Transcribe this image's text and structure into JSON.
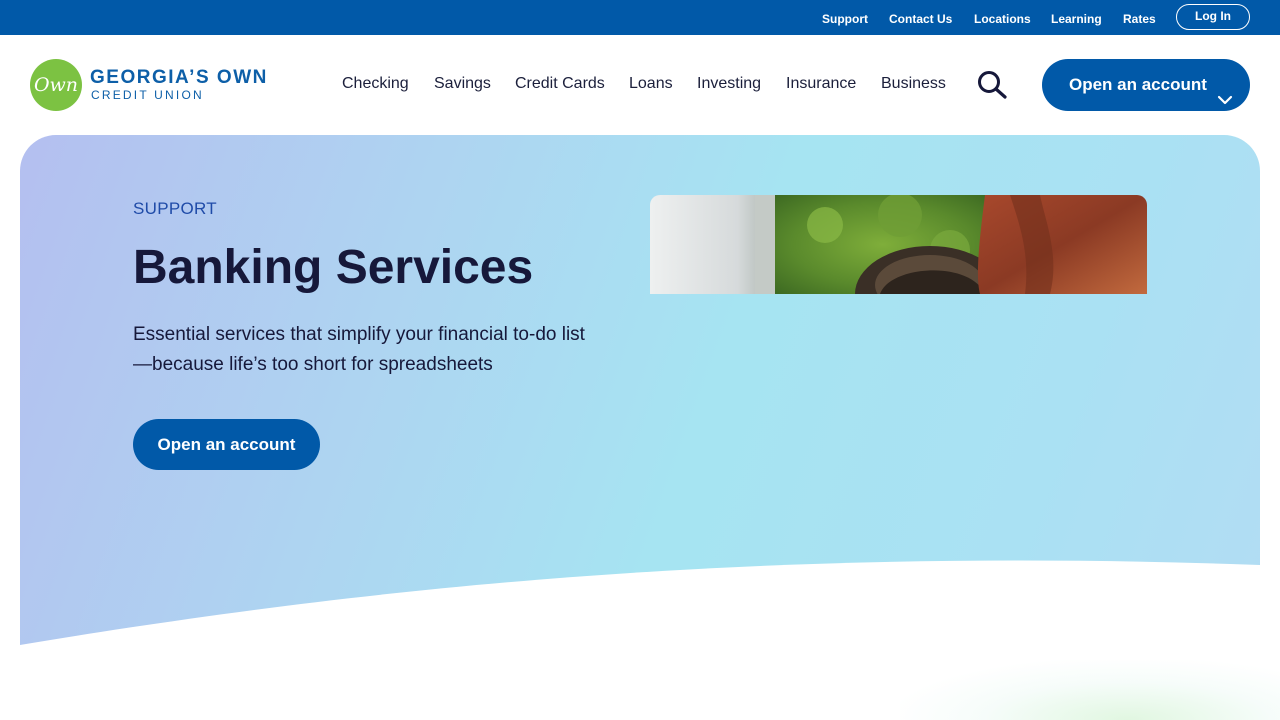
{
  "utility_nav": {
    "links": [
      "Support",
      "Contact Us",
      "Locations",
      "Learning",
      "Rates"
    ],
    "login_label": "Log In",
    "background": "#0159a8"
  },
  "logo": {
    "mark_text": "Own",
    "title": "GEORGIA’S OWN",
    "subtitle": "CREDIT UNION",
    "mark_color": "#7cc242",
    "text_color": "#0d5fa8"
  },
  "main_nav": {
    "items": [
      "Checking",
      "Savings",
      "Credit Cards",
      "Loans",
      "Investing",
      "Insurance",
      "Business"
    ],
    "search_icon": "search-icon",
    "cta_label": "Open an account",
    "cta_icon": "chevron-down-icon"
  },
  "hero": {
    "eyebrow": "SUPPORT",
    "title": "Banking Services",
    "description": "Essential services that simplify your financial to-do list—because life’s too short for spreadsheets",
    "cta_label": "Open an account",
    "accent": "#0159a8",
    "title_color": "#16183a",
    "eyebrow_color": "#1f4ba8"
  }
}
